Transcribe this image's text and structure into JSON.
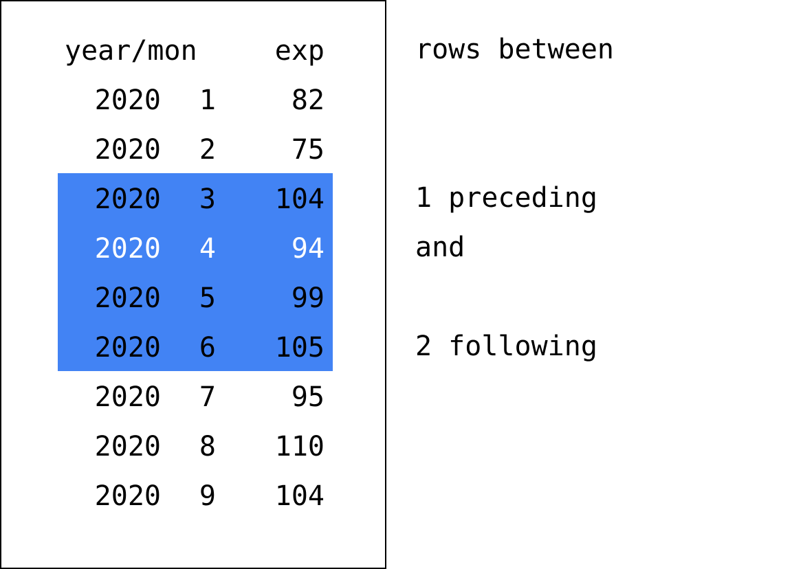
{
  "table": {
    "headers": {
      "year_mon": "year/mon",
      "exp": "exp"
    },
    "rows": [
      {
        "year": "2020",
        "mon": "1",
        "exp": "82"
      },
      {
        "year": "2020",
        "mon": "2",
        "exp": "75"
      },
      {
        "year": "2020",
        "mon": "3",
        "exp": "104"
      },
      {
        "year": "2020",
        "mon": "4",
        "exp": "94"
      },
      {
        "year": "2020",
        "mon": "5",
        "exp": "99"
      },
      {
        "year": "2020",
        "mon": "6",
        "exp": "105"
      },
      {
        "year": "2020",
        "mon": "7",
        "exp": "95"
      },
      {
        "year": "2020",
        "mon": "8",
        "exp": "110"
      },
      {
        "year": "2020",
        "mon": "9",
        "exp": "104"
      }
    ],
    "highlight_color": "#4283f4",
    "current_row_index": 3,
    "window_rows": [
      2,
      3,
      4,
      5
    ]
  },
  "annotations": {
    "title": "rows between",
    "preceding": "1 preceding",
    "and": "and",
    "following": "2 following"
  }
}
